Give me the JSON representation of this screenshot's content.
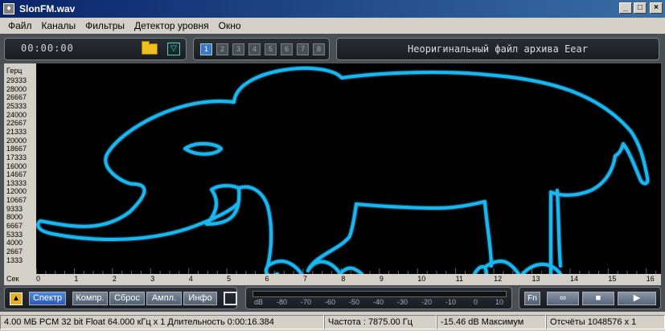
{
  "window": {
    "title": "SlonFM.wav"
  },
  "menu": [
    "Файл",
    "Каналы",
    "Фильтры",
    "Детектор уровня",
    "Окно"
  ],
  "toolbar": {
    "time": "00:00:00",
    "channels": [
      "1",
      "2",
      "3",
      "4",
      "5",
      "6",
      "7",
      "8"
    ],
    "active_channel": "1",
    "info_text": "Неоригинальный файл архива Eear"
  },
  "chart_data": {
    "type": "heatmap",
    "ylabel": "Герц",
    "xlabel": "Сек",
    "y_ticks": [
      "29333",
      "28000",
      "26667",
      "25333",
      "24000",
      "22667",
      "21333",
      "20000",
      "18667",
      "17333",
      "16000",
      "14667",
      "13333",
      "12000",
      "10667",
      "9333",
      "8000",
      "6667",
      "5333",
      "4000",
      "2667",
      "1333"
    ],
    "x_ticks": [
      "0",
      "1",
      "2",
      "3",
      "4",
      "5",
      "6",
      "7",
      "8",
      "9",
      "10",
      "11",
      "12",
      "13",
      "14",
      "15",
      "16"
    ],
    "xlim": [
      0,
      16.384
    ],
    "ylim": [
      0,
      32000
    ],
    "trace_color": "#19b6f0"
  },
  "controls": {
    "spectrum": "Спектр",
    "compress": "Компр.",
    "reset": "Сброс",
    "amplitude": "Ампл.",
    "info": "Инфо",
    "db_labels": [
      "dB",
      "-80",
      "-70",
      "-60",
      "-50",
      "-40",
      "-30",
      "-20",
      "-10",
      "0",
      "10"
    ],
    "fn": "Fn"
  },
  "status": {
    "format": "4.00 МБ PCM 32 bit Float 64.000 кГц x 1  Длительность 0:00:16.384",
    "frequency": "Частота : 7875.00 Гц",
    "level": "-15.46 dB Максимум",
    "samples": "Отсчёты 1048576 x 1"
  }
}
